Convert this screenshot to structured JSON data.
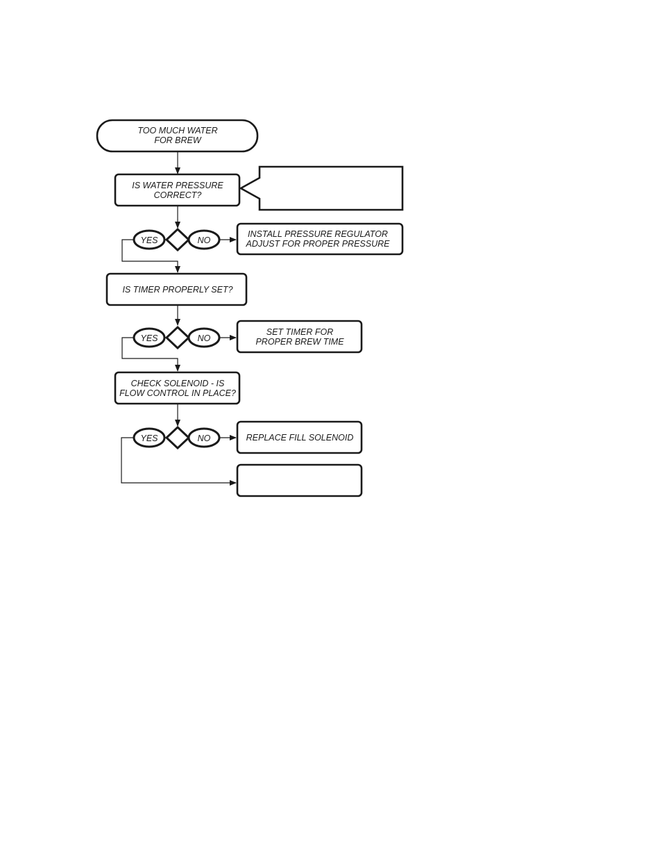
{
  "flowchart": {
    "start": {
      "lines": [
        "TOO MUCH WATER",
        "FOR BREW"
      ]
    },
    "step1": {
      "lines": [
        "IS WATER PRESSURE",
        "CORRECT?"
      ]
    },
    "callout": {
      "lines": []
    },
    "decision1": {
      "yes": "YES",
      "no": "NO"
    },
    "action1": {
      "lines": [
        "INSTALL PRESSURE REGULATOR",
        "ADJUST FOR PROPER PRESSURE"
      ]
    },
    "step2": {
      "lines": [
        "IS TIMER PROPERLY SET?"
      ]
    },
    "decision2": {
      "yes": "YES",
      "no": "NO"
    },
    "action2": {
      "lines": [
        "SET TIMER FOR",
        "PROPER BREW TIME"
      ]
    },
    "step3": {
      "lines": [
        "CHECK SOLENOID - IS",
        "FLOW CONTROL IN PLACE?"
      ]
    },
    "decision3": {
      "yes": "YES",
      "no": "NO"
    },
    "action3": {
      "lines": [
        "REPLACE FILL SOLENOID"
      ]
    },
    "final": {
      "lines": []
    }
  }
}
